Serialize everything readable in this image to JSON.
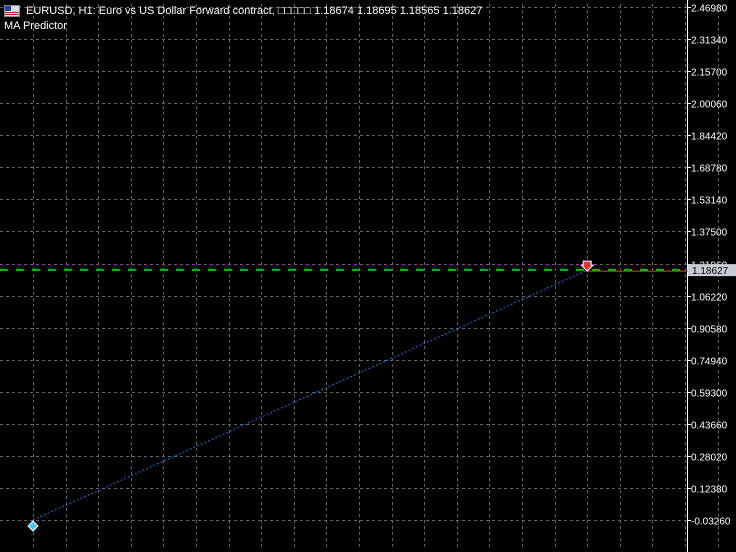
{
  "header": {
    "flag_icon": "eu-us-flag-icon",
    "title": "EURUSD, H1:  Euro vs US Dollar Forward contract, □□□□□  1.18674 1.18695 1.18565 1.18627",
    "indicator": "MA Predictor"
  },
  "colors": {
    "background": "#000000",
    "grid": "#5a6770",
    "axis_text": "#ffffff",
    "ma_line": "#1f77d4",
    "dashed_level": "#00c000",
    "current_price_box": "#c9cdd2",
    "sell_arrow": "#e53935",
    "buy_arrow": "#4fc3f7"
  },
  "chart_data": {
    "type": "line",
    "symbol": "EURUSD",
    "timeframe": "H1",
    "ohlc": {
      "open": 1.18674,
      "high": 1.18695,
      "low": 1.18565,
      "close": 1.18627
    },
    "y_ticks": [
      "2.46980",
      "2.31340",
      "2.15700",
      "2.00060",
      "1.84420",
      "1.68780",
      "1.53140",
      "1.37500",
      "1.21860",
      "1.06220",
      "0.90580",
      "0.74940",
      "0.59300",
      "0.43660",
      "0.28020",
      "0.12380",
      "-0.03260"
    ],
    "ylim": [
      -0.0326,
      2.4698
    ],
    "current_price_label": "1.18627",
    "current_price": 1.18627,
    "ma_line_label": "MA Predictor",
    "ma_line": [
      {
        "bar": 0,
        "value": -0.0326
      },
      {
        "bar": 17,
        "value": 1.1862
      }
    ],
    "dashed_level": 1.1877,
    "orange_segment": [
      {
        "bar": 17,
        "value": 1.1862
      },
      {
        "bar": 22,
        "value": 1.1862
      }
    ],
    "markers": [
      {
        "name": "sell-arrow-icon",
        "bar": 17,
        "value": 1.1862,
        "kind": "sell"
      },
      {
        "name": "buy-arrow-icon",
        "bar": 22,
        "value": 1.1862,
        "kind": "buy"
      },
      {
        "name": "start-marker-icon",
        "bar": 0,
        "value": -0.0326,
        "kind": "buy"
      }
    ],
    "bars_visible": 23,
    "grid": true
  }
}
